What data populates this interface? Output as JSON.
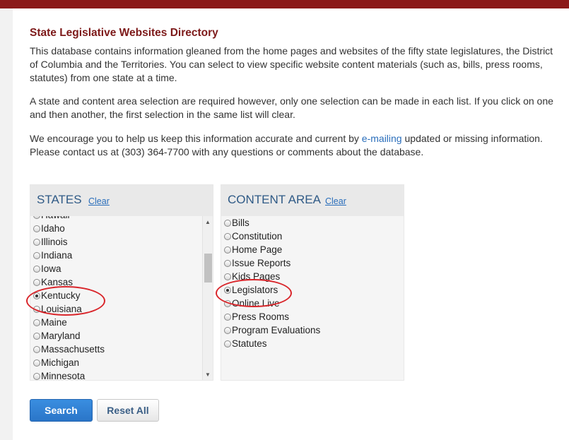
{
  "header": {
    "title": "State Legislative Websites Directory"
  },
  "intro": {
    "p1": "This database contains information gleaned from the home pages and websites of the fifty state legislatures, the District of Columbia and the Territories. You can select to view specific website content materials (such as, bills, press rooms, statutes) from one state at a time.",
    "p2": "A state and content area selection are required however, only one selection can be made in each list. If you click on one and then another, the first selection in the same list will clear.",
    "p3_before": "We encourage you to help us keep this information accurate and current by ",
    "p3_link": "e-mailing",
    "p3_after": " updated or missing information. Please contact us at (303) 364-7700 with any questions or comments about the database."
  },
  "states": {
    "heading": "STATES",
    "clear": "Clear",
    "selected": "Kentucky",
    "items": [
      "Hawaii",
      "Idaho",
      "Illinois",
      "Indiana",
      "Iowa",
      "Kansas",
      "Kentucky",
      "Louisiana",
      "Maine",
      "Maryland",
      "Massachusetts",
      "Michigan",
      "Minnesota"
    ]
  },
  "content_area": {
    "heading": "CONTENT AREA",
    "clear": "Clear",
    "selected": "Legislators",
    "items": [
      "Bills",
      "Constitution",
      "Home Page",
      "Issue Reports",
      "Kids Pages",
      "Legislators",
      "Online Live",
      "Press Rooms",
      "Program Evaluations",
      "Statutes"
    ]
  },
  "buttons": {
    "search": "Search",
    "reset": "Reset All"
  },
  "colors": {
    "brand": "#8b1a1a",
    "link": "#2a6ebb",
    "annotation": "#d9252a",
    "primary_button": "#2a75c8"
  }
}
